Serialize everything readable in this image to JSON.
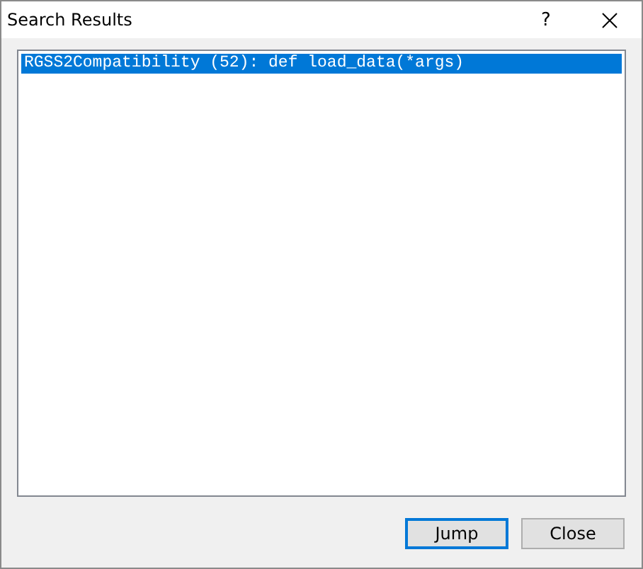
{
  "window": {
    "title": "Search Results",
    "help": "?"
  },
  "results": [
    {
      "text": "RGSS2Compatibility (52): def load_data(*args)",
      "selected": true
    }
  ],
  "buttons": [
    {
      "label": "Jump",
      "default": true
    },
    {
      "label": "Close",
      "default": false
    }
  ]
}
